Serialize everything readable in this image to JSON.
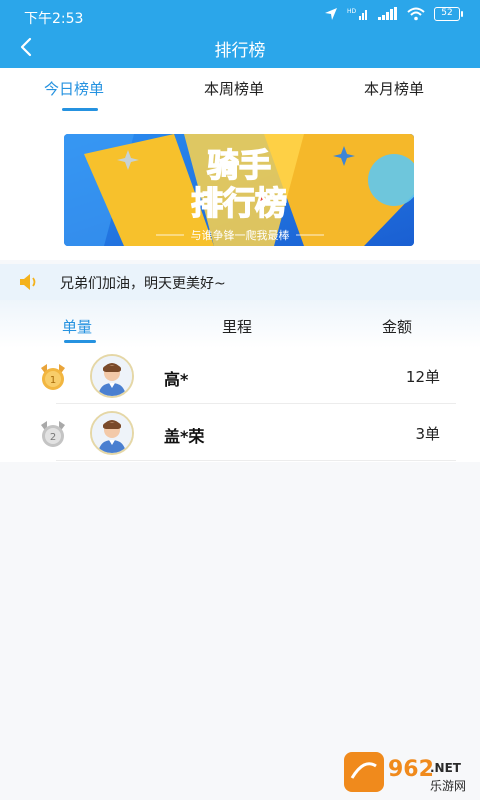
{
  "status_bar": {
    "time": "下午2:53",
    "battery": "52"
  },
  "header": {
    "title": "排行榜"
  },
  "period_tabs": [
    {
      "label": "今日榜单"
    },
    {
      "label": "本周榜单"
    },
    {
      "label": "本月榜单"
    }
  ],
  "banner": {
    "line1": "骑手",
    "line2": "排行榜",
    "slogan": "与谁争锋一爬我最棒"
  },
  "notice": {
    "text": "兄弟们加油，明天更美好~"
  },
  "metric_tabs": [
    {
      "label": "单量"
    },
    {
      "label": "里程"
    },
    {
      "label": "金额"
    }
  ],
  "ranking": [
    {
      "rank": "1",
      "name": "高*",
      "value": "12单"
    },
    {
      "rank": "2",
      "name": "盖*荣",
      "value": "3单"
    }
  ],
  "watermark": {
    "main": "962",
    "suffix": ".NET",
    "sub": "乐游网"
  },
  "colors": {
    "header": "#2ba6ea",
    "accent": "#2592e0"
  }
}
